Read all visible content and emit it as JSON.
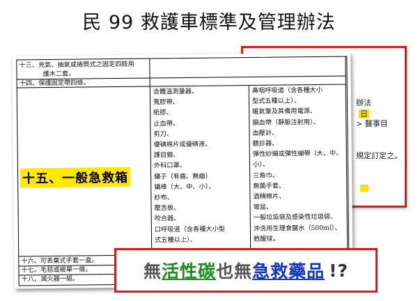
{
  "title": "民 99  救護車標準及管理辦法",
  "background_doc": {
    "line1": "辦法",
    "line2": "日",
    "line3": "> 醫事目",
    "line4": "規定訂定之。"
  },
  "table": {
    "row13": [
      "十三、充氣、抽氣或捲筒式之固定四肢用",
      "護木二套。"
    ],
    "row14": "十四、保護固定帶四條。",
    "row15_label": "十五、一般急救箱",
    "row15_col1": [
      "含體溫測量器、",
      "寬膠帶、",
      "紙膠、",
      "止血帶、",
      "剪刀、",
      "優碘棉片或優碘液、",
      "護目鏡、",
      "外科口罩、",
      "鑷子（有齒、無齒）",
      "鑷棒（大、中、小）、",
      "紗布、",
      "壓舌板、",
      "咬合器、",
      "口呼吸道（含各種大小型",
      "式五種以上）、"
    ],
    "row15_col2": [
      "鼻咽呼吸道（含各種大小",
      "型式五種以上）、",
      "暖氣筆及其備用電源、",
      "膈血帶（靜脈注射用）、",
      "血壓計、",
      "聽診器、",
      "彈性紗繃或彈性繃帶（大、中、",
      "小）、",
      "三角巾、",
      "無菌手套、",
      "酒精棉片、",
      "彎盆、",
      "一般垃圾袋及感染性垃圾袋、",
      "沖洗用生理食鹽水（500ml）、",
      "甦醒球。"
    ],
    "row16": "十六、可丟棄式手套一盒。",
    "row17": "十七、毛毯或被單一條。",
    "row18": "十八、滅火器一組。"
  },
  "callout": {
    "part1": "無",
    "part2": "活性碳",
    "part3": "也無",
    "part4": "急救藥品",
    "part5": "!?"
  }
}
